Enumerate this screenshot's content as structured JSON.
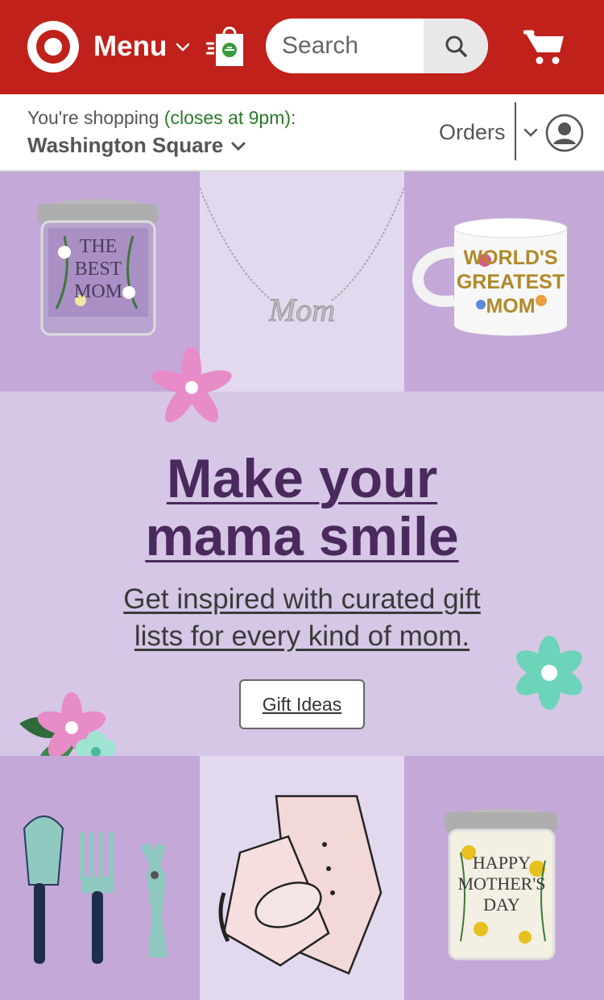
{
  "header": {
    "menu_label": "Menu",
    "search_placeholder": "Search",
    "brand_color": "#c0211a"
  },
  "store_bar": {
    "shopping_prefix": "You're shopping",
    "closes": "(closes at 9pm)",
    "colon": ":",
    "store_name": "Washington Square",
    "orders_label": "Orders"
  },
  "hero": {
    "headline_line1": "Make your",
    "headline_line2": "mama smile",
    "subtext_line1": "Get inspired with curated gift",
    "subtext_line2": "lists for every kind of mom.",
    "cta_label": "Gift Ideas",
    "background_color": "#d6c7e6",
    "headline_color": "#4a2a5c"
  },
  "products": {
    "candle_top_text": [
      "THE",
      "BEST",
      "MOM"
    ],
    "necklace_text": "Mom",
    "mug_text": [
      "WORLD'S",
      "GREATEST",
      "MOM"
    ],
    "candle_bottom_text": [
      "HAPPY",
      "MOTHER'S",
      "DAY"
    ]
  },
  "icons": {
    "logo": "target-bullseye-icon",
    "menu_chevron": "chevron-down-icon",
    "bag": "drive-up-bag-icon",
    "search": "search-icon",
    "cart": "cart-icon",
    "account": "account-icon"
  }
}
